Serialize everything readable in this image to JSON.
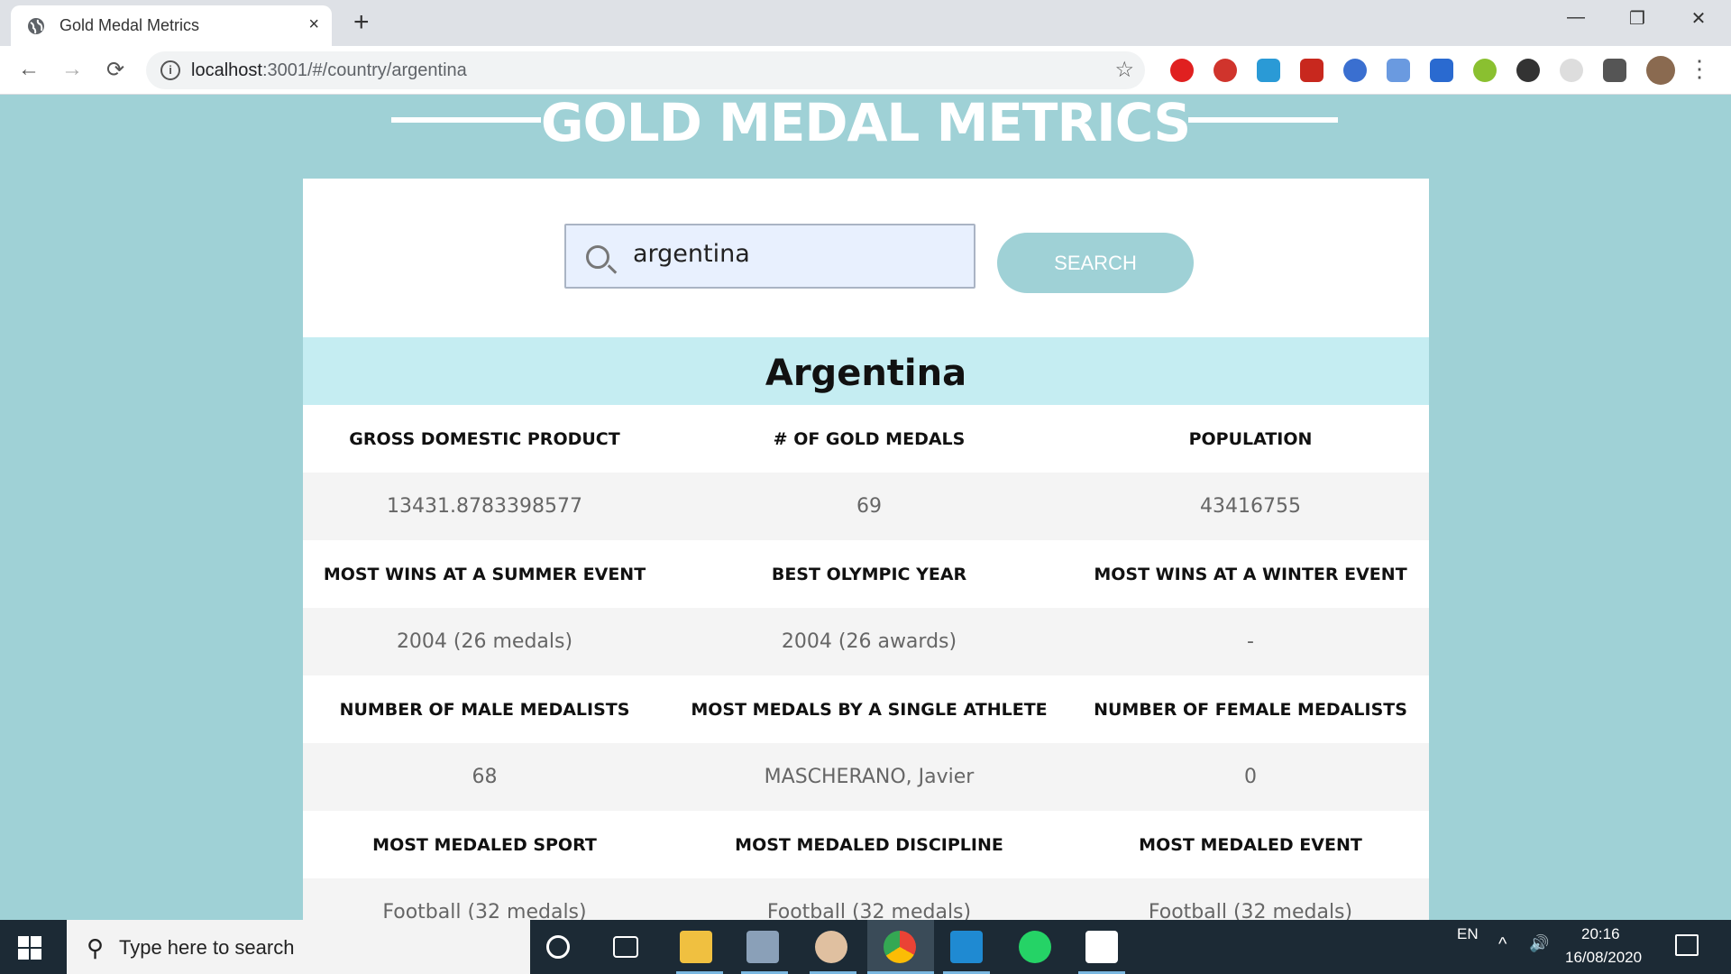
{
  "browser": {
    "tab_title": "Gold Medal Metrics",
    "new_tab": "+",
    "close_tab": "×",
    "url_host": "localhost",
    "url_path": ":3001/#/country/argentina",
    "back": "←",
    "forward": "→",
    "reload": "⟳",
    "star": "☆",
    "menu": "⋮",
    "minimize": "—",
    "restore": "❐",
    "close": "✕"
  },
  "page": {
    "title": "GOLD MEDAL METRICS",
    "search_value": "argentina",
    "search_button": "SEARCH",
    "country": "Argentina",
    "rows": [
      {
        "labels": [
          "GROSS DOMESTIC PRODUCT",
          "# OF GOLD MEDALS",
          "POPULATION"
        ],
        "values": [
          "13431.8783398577",
          "69",
          "43416755"
        ]
      },
      {
        "labels": [
          "MOST WINS AT A SUMMER EVENT",
          "BEST OLYMPIC YEAR",
          "MOST WINS AT A WINTER EVENT"
        ],
        "values": [
          "2004 (26 medals)",
          "2004 (26 awards)",
          "-"
        ]
      },
      {
        "labels": [
          "NUMBER OF MALE MEDALISTS",
          "MOST MEDALS BY A SINGLE ATHLETE",
          "NUMBER OF FEMALE MEDALISTS"
        ],
        "values": [
          "68",
          "MASCHERANO, Javier",
          "0"
        ]
      },
      {
        "labels": [
          "MOST MEDALED SPORT",
          "MOST MEDALED DISCIPLINE",
          "MOST MEDALED EVENT"
        ],
        "values": [
          "Football (32 medals)",
          "Football (32 medals)",
          "Football (32 medals)"
        ]
      }
    ]
  },
  "taskbar": {
    "search_placeholder": "Type here to search",
    "language": "EN",
    "time": "20:16",
    "date": "16/08/2020"
  },
  "colors": {
    "page_bg": "#9fd1d6",
    "country_bar": "#c5edf2",
    "button": "#9fd1d6"
  }
}
